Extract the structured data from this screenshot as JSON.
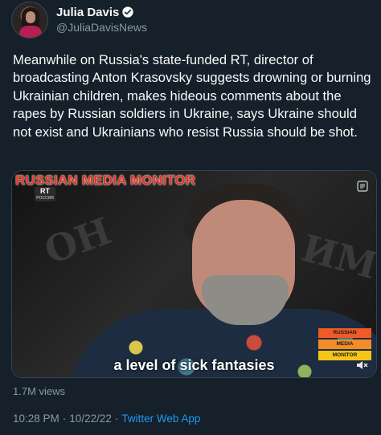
{
  "tweet": {
    "author": {
      "display_name": "Julia Davis",
      "handle": "@JuliaDavisNews",
      "verified": true
    },
    "more_icon": "more-icon",
    "text": "Meanwhile on Russia's state-funded RT, director of broadcasting Anton Krasovsky suggests drowning or burning Ukrainian children, makes hideous comments about the rapes by Russian soldiers in Ukraine, says Ukraine should not exist and Ukrainians who resist Russia should be shot.",
    "media": {
      "overlay_title": "RUSSIAN MEDIA MONITOR",
      "rt_logo": {
        "main": "RT",
        "sub": "РОССИЯ"
      },
      "badge_lines": [
        "RUSSIAN",
        "MEDIA",
        "MONITOR"
      ],
      "caption": "a level of sick fantasies",
      "colors": {
        "title": "#e33424",
        "badge_1": "#f05a28",
        "badge_2": "#f28c28",
        "badge_3": "#f5c518"
      }
    },
    "views": "1.7M views",
    "time": "10:28 PM",
    "separator": "·",
    "date": "10/22/22",
    "source": "Twitter Web App"
  },
  "colors": {
    "background": "#15202b",
    "text": "#f7f9f9",
    "secondary": "#8b98a5",
    "link": "#1d9bf0",
    "verified": "#1d9bf0"
  }
}
